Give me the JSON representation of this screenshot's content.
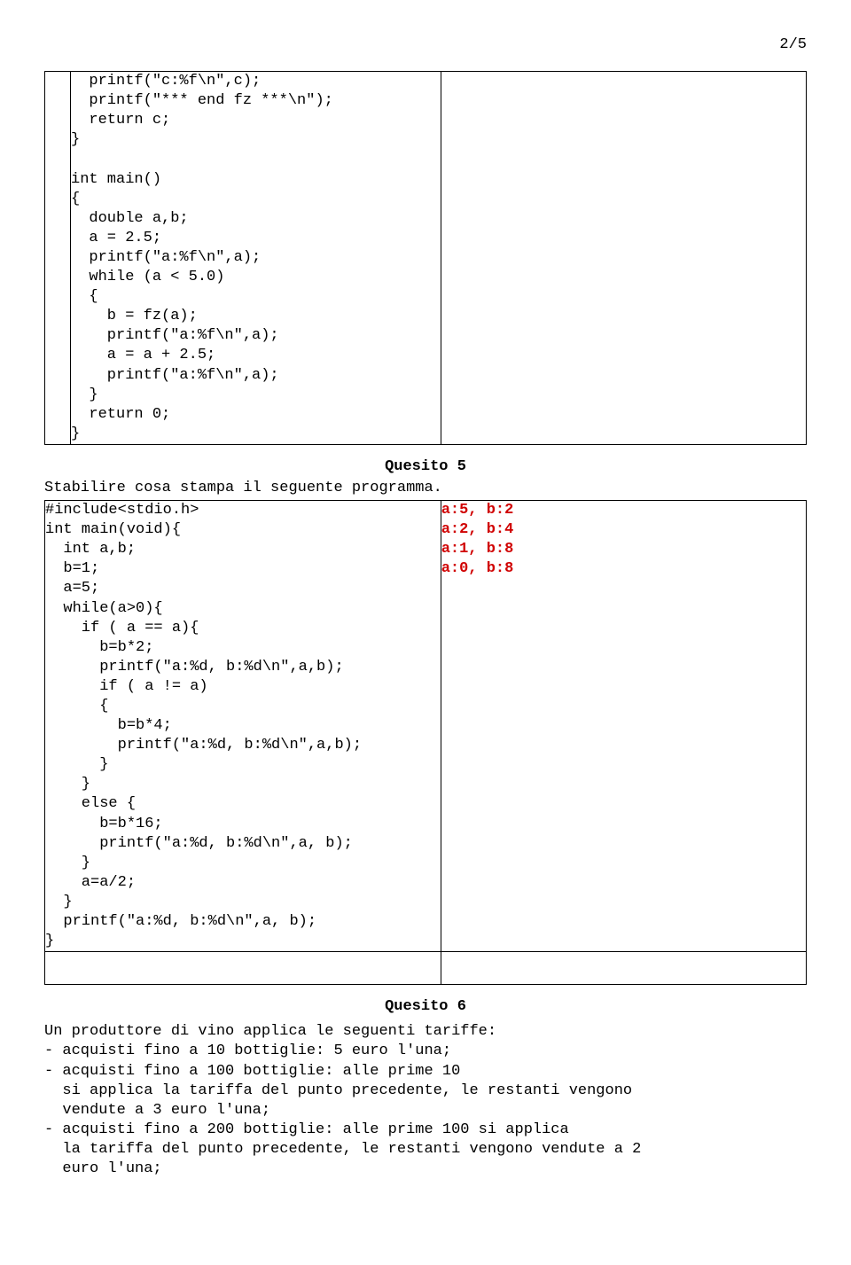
{
  "page_number": "2/5",
  "block1_code": "  printf(\"c:%f\\n\",c);\n  printf(\"*** end fz ***\\n\");\n  return c;\n}\n\nint main()\n{\n  double a,b;\n  a = 2.5;\n  printf(\"a:%f\\n\",a);\n  while (a < 5.0)\n  {\n    b = fz(a);\n    printf(\"a:%f\\n\",a);\n    a = a + 2.5;\n    printf(\"a:%f\\n\",a);\n  }\n  return 0;\n}",
  "q5": {
    "title": "Quesito 5",
    "intro": "Stabilire cosa stampa il seguente programma.",
    "code": "#include<stdio.h>\nint main(void){\n  int a,b;\n  b=1;\n  a=5;\n  while(a>0){\n    if ( a == a){\n      b=b*2;\n      printf(\"a:%d, b:%d\\n\",a,b);\n      if ( a != a)\n      {\n        b=b*4;\n        printf(\"a:%d, b:%d\\n\",a,b);\n      }\n    }\n    else {\n      b=b*16;\n      printf(\"a:%d, b:%d\\n\",a, b);\n    }\n    a=a/2;\n  }\n  printf(\"a:%d, b:%d\\n\",a, b);\n}",
    "answer": "a:5, b:2\na:2, b:4\na:1, b:8\na:0, b:8"
  },
  "q6": {
    "title": "Quesito 6",
    "body": "Un produttore di vino applica le seguenti tariffe:\n- acquisti fino a 10 bottiglie: 5 euro l'una;\n- acquisti fino a 100 bottiglie: alle prime 10\n  si applica la tariffa del punto precedente, le restanti vengono\n  vendute a 3 euro l'una;\n- acquisti fino a 200 bottiglie: alle prime 100 si applica\n  la tariffa del punto precedente, le restanti vengono vendute a 2\n  euro l'una;"
  }
}
